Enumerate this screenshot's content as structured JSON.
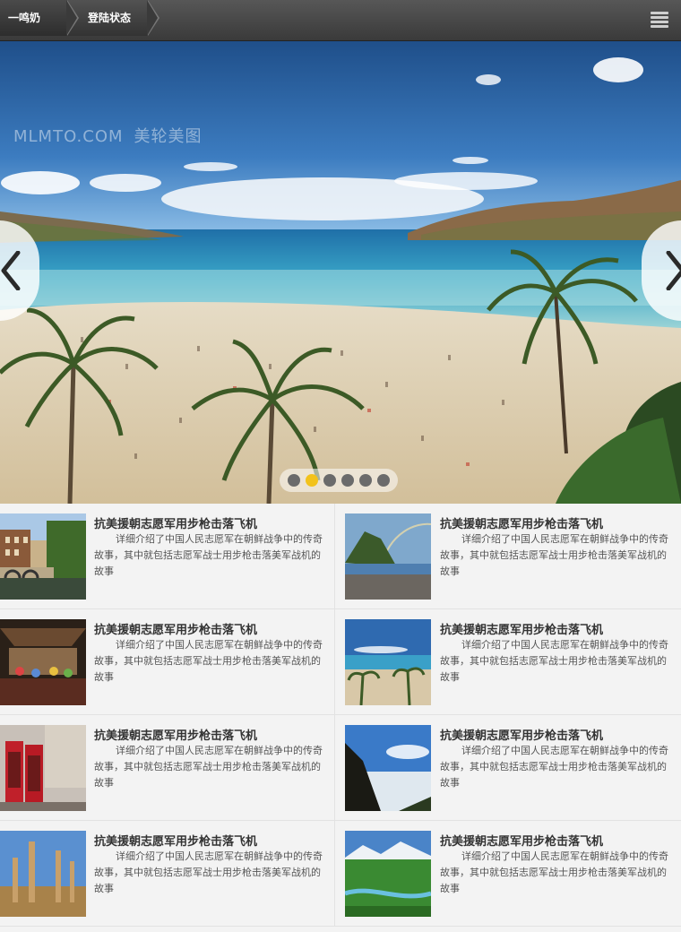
{
  "header": {
    "breadcrumbs": [
      {
        "label": "一鸣奶吧"
      },
      {
        "label": "登陆状态"
      }
    ],
    "menu_icon": "hamburger-menu-icon"
  },
  "banner": {
    "watermark_latin": "MLMTO.COM",
    "watermark_cn": "美轮美图",
    "prev_icon": "chevron-left-icon",
    "next_icon": "chevron-right-icon",
    "slide_count": 6,
    "active_slide": 2,
    "active_dot_color": "#f2c21b"
  },
  "articles": [
    {
      "title": "抗美援朝志愿军用步枪击落飞机",
      "desc": "详细介绍了中国人民志愿军在朝鲜战争中的传奇故事，其中就包括志愿军战士用步枪击落美军战机的故事"
    },
    {
      "title": "抗美援朝志愿军用步枪击落飞机",
      "desc": "详细介绍了中国人民志愿军在朝鲜战争中的传奇故事，其中就包括志愿军战士用步枪击落美军战机的故事"
    },
    {
      "title": "抗美援朝志愿军用步枪击落飞机",
      "desc": "详细介绍了中国人民志愿军在朝鲜战争中的传奇故事，其中就包括志愿军战士用步枪击落美军战机的故事"
    },
    {
      "title": "抗美援朝志愿军用步枪击落飞机",
      "desc": "详细介绍了中国人民志愿军在朝鲜战争中的传奇故事，其中就包括志愿军战士用步枪击落美军战机的故事"
    },
    {
      "title": "抗美援朝志愿军用步枪击落飞机",
      "desc": "详细介绍了中国人民志愿军在朝鲜战争中的传奇故事，其中就包括志愿军战士用步枪击落美军战机的故事"
    },
    {
      "title": "抗美援朝志愿军用步枪击落飞机",
      "desc": "详细介绍了中国人民志愿军在朝鲜战争中的传奇故事，其中就包括志愿军战士用步枪击落美军战机的故事"
    },
    {
      "title": "抗美援朝志愿军用步枪击落飞机",
      "desc": "详细介绍了中国人民志愿军在朝鲜战争中的传奇故事，其中就包括志愿军战士用步枪击落美军战机的故事"
    },
    {
      "title": "抗美援朝志愿军用步枪击落飞机",
      "desc": "详细介绍了中国人民志愿军在朝鲜战争中的传奇故事，其中就包括志愿军战士用步枪击落美军战机的故事"
    }
  ]
}
